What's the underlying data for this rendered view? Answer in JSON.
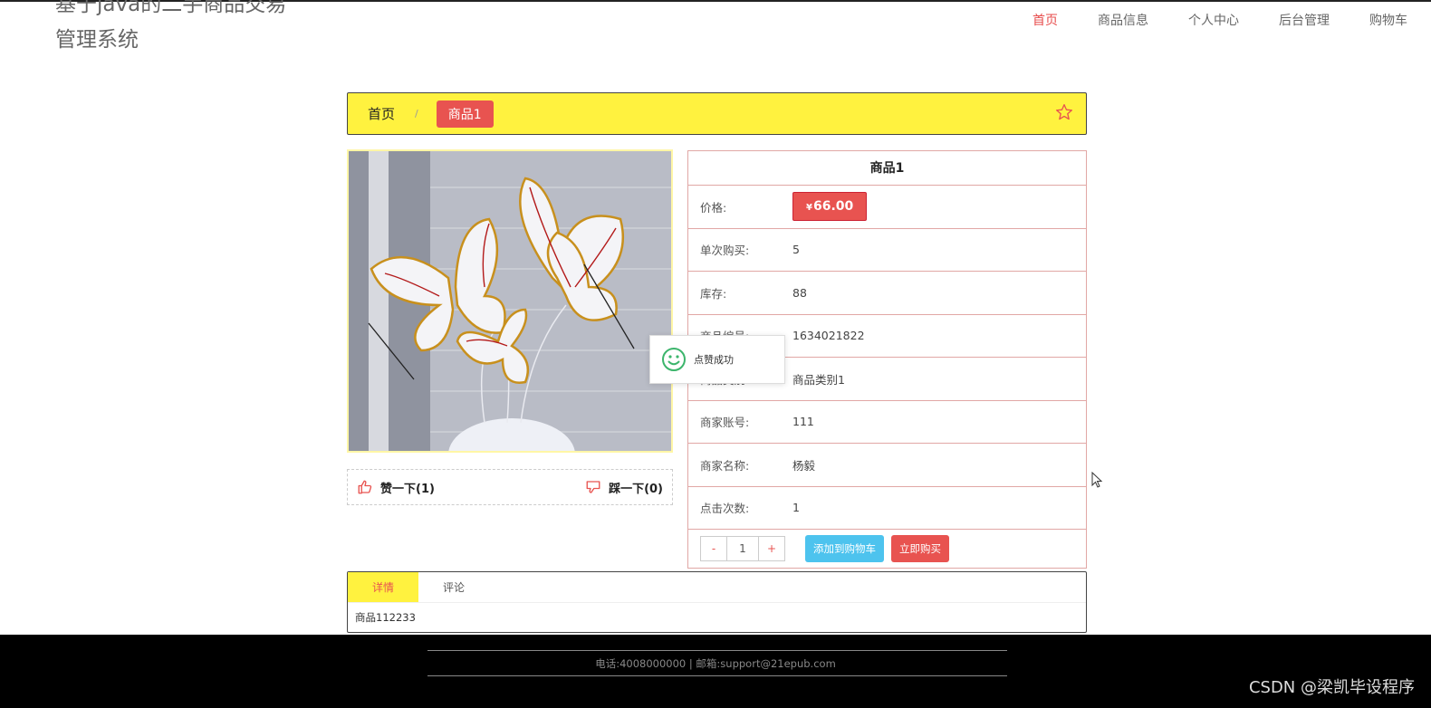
{
  "header": {
    "site_title": "基于java的二手商品交易管理系统",
    "nav": [
      {
        "label": "首页",
        "active": true
      },
      {
        "label": "商品信息",
        "active": false
      },
      {
        "label": "个人中心",
        "active": false
      },
      {
        "label": "后台管理",
        "active": false
      },
      {
        "label": "购物车",
        "active": false
      }
    ]
  },
  "breadcrumb": {
    "home": "首页",
    "separator": "/",
    "current": "商品1",
    "star_icon": "star-outline-icon"
  },
  "product": {
    "name": "商品1",
    "price_label": "价格:",
    "currency": "¥",
    "price": "66.00",
    "rows": [
      {
        "label": "单次购买:",
        "value": "5"
      },
      {
        "label": "库存:",
        "value": "88"
      },
      {
        "label": "商品编号:",
        "value": "1634021822"
      },
      {
        "label": "商品类别:",
        "value": "商品类别1"
      },
      {
        "label": "商家账号:",
        "value": "111"
      },
      {
        "label": "商家名称:",
        "value": "杨毅"
      },
      {
        "label": "点击次数:",
        "value": "1"
      }
    ],
    "quantity": {
      "minus": "-",
      "value": "1",
      "plus": "+"
    },
    "add_to_cart": "添加到购物车",
    "buy_now": "立即购买"
  },
  "votes": {
    "like": "赞一下(1)",
    "dislike": "踩一下(0)"
  },
  "toast": {
    "text": "点赞成功",
    "icon": "smile-icon"
  },
  "tabs": {
    "items": [
      "详情",
      "评论"
    ],
    "active": 0,
    "content": "商品112233"
  },
  "footer": {
    "contact": "电话:4008000000 | 邮箱:support@21epub.com",
    "watermark": "CSDN @梁凯毕设程序"
  },
  "colors": {
    "accent": "#e85350",
    "highlight": "#fff23f",
    "cart_button": "#4dc3ee"
  }
}
